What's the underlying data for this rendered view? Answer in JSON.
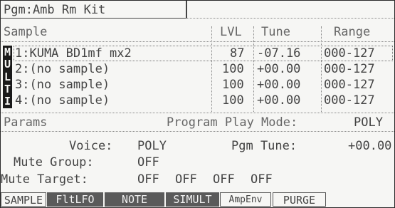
{
  "title": "Pgm:Amb Rm Kit",
  "sample_table": {
    "header": {
      "sample": "Sample",
      "level": "LVL",
      "tune": "Tune",
      "range": "Range"
    },
    "badge_letters": [
      "M",
      "U",
      "L",
      "T",
      "I"
    ],
    "rows": [
      {
        "name": "1:KUMA BD1mf mx2",
        "level": "87",
        "tune": "-07.16",
        "range": "000-127"
      },
      {
        "name": "2:(no sample)",
        "level": "100",
        "tune": "+00.00",
        "range": "000-127"
      },
      {
        "name": "3:(no sample)",
        "level": "100",
        "tune": "+00.00",
        "range": "000-127"
      },
      {
        "name": "4:(no sample)",
        "level": "100",
        "tune": "+00.00",
        "range": "000-127"
      }
    ]
  },
  "params": {
    "header": "Params",
    "play_mode_label": "Program Play Mode:",
    "play_mode_value": "POLY",
    "voice_label": "Voice:",
    "voice_value": "POLY",
    "pgm_tune_label": "Pgm Tune:",
    "pgm_tune_value": "+00.00",
    "mute_group_label": "Mute Group:",
    "mute_group_value": "OFF",
    "mute_target_label": "Mute Target:",
    "mute_targets": [
      "OFF",
      "OFF",
      "OFF",
      "OFF"
    ]
  },
  "softkeys": [
    "SAMPLE",
    "FltLFO",
    "NOTE",
    "SIMULT",
    "AmpEnv",
    "PURGE"
  ]
}
